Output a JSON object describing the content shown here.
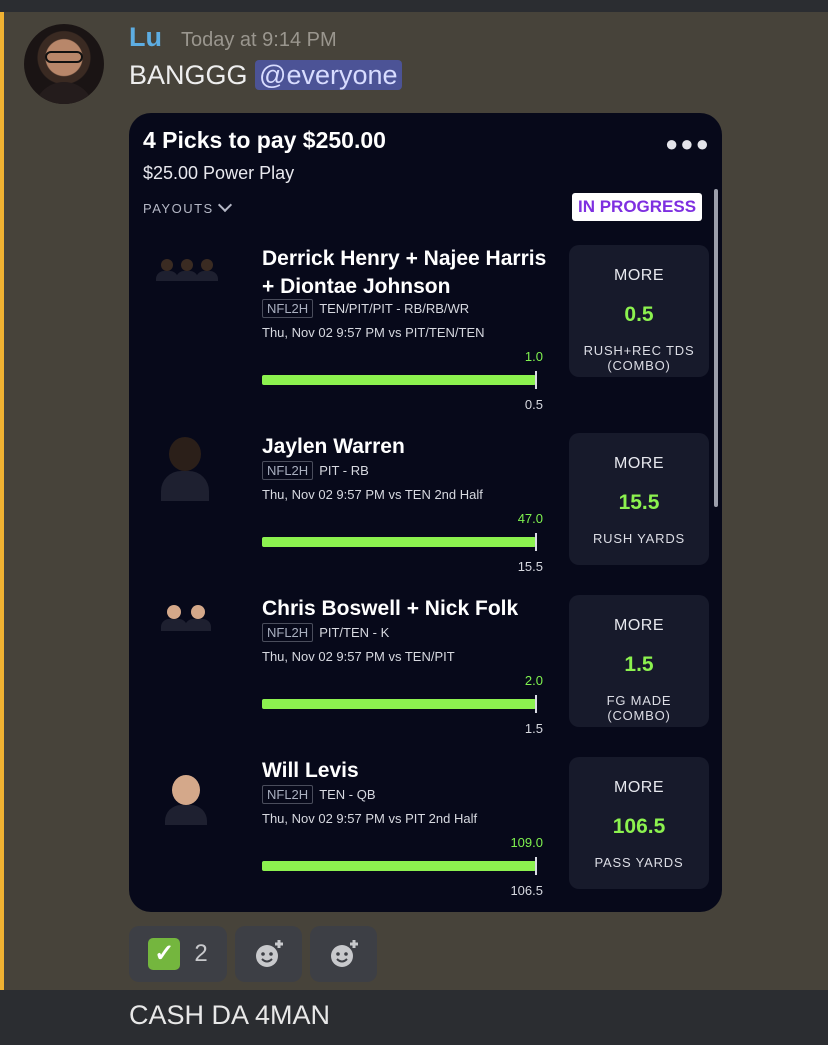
{
  "message": {
    "username": "Lu",
    "timestamp": "Today at 9:14 PM",
    "text": "BANGGG",
    "mention": "@everyone"
  },
  "card": {
    "title": "4 Picks to pay $250.00",
    "subtitle": "$25.00 Power Play",
    "payouts_label": "PAYOUTS",
    "status": "IN PROGRESS",
    "more_icon": "ellipsis-icon",
    "picks": [
      {
        "name": "Derrick Henry + Najee Harris + Diontae Johnson",
        "league": "NFL2H",
        "teams": "TEN/PIT/PIT - RB/RB/WR",
        "game": "Thu, Nov 02 9:57 PM  vs PIT/TEN/TEN",
        "current": "1.0",
        "target": "0.5",
        "progress": 1.0,
        "direction": "MORE",
        "line": "0.5",
        "stat": "RUSH+REC TDS\n(COMBO)"
      },
      {
        "name": "Jaylen Warren",
        "league": "NFL2H",
        "teams": "PIT - RB",
        "game": "Thu, Nov 02 9:57 PM  vs TEN 2nd Half",
        "current": "47.0",
        "target": "15.5",
        "progress": 1.0,
        "direction": "MORE",
        "line": "15.5",
        "stat": "RUSH YARDS"
      },
      {
        "name": "Chris Boswell + Nick Folk",
        "league": "NFL2H",
        "teams": "PIT/TEN - K",
        "game": "Thu, Nov 02 9:57 PM  vs TEN/PIT",
        "current": "2.0",
        "target": "1.5",
        "progress": 1.0,
        "direction": "MORE",
        "line": "1.5",
        "stat": "FG MADE\n(COMBO)"
      },
      {
        "name": "Will Levis",
        "league": "NFL2H",
        "teams": "TEN - QB",
        "game": "Thu, Nov 02 9:57 PM  vs PIT 2nd Half",
        "current": "109.0",
        "target": "106.5",
        "progress": 1.0,
        "direction": "MORE",
        "line": "106.5",
        "stat": "PASS YARDS"
      }
    ]
  },
  "reactions": [
    {
      "emoji": "✅",
      "count": "2"
    },
    {
      "icon": "add-reaction-icon"
    },
    {
      "icon": "add-reaction-icon"
    }
  ],
  "next_message": "CASH DA 4MAN"
}
